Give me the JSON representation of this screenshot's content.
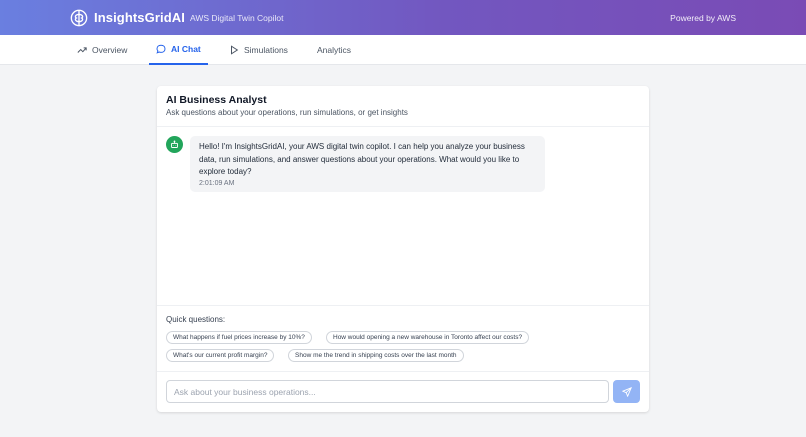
{
  "header": {
    "brand": "InsightsGridAI",
    "tagline": "AWS Digital Twin Copilot",
    "powered_by": "Powered by AWS"
  },
  "nav": {
    "tabs": [
      {
        "label": "Overview",
        "icon": "trending-up-icon",
        "active": false
      },
      {
        "label": "AI Chat",
        "icon": "chat-bubble-icon",
        "active": true
      },
      {
        "label": "Simulations",
        "icon": "play-icon",
        "active": false
      },
      {
        "label": "Analytics",
        "icon": "",
        "active": false
      }
    ]
  },
  "chat": {
    "title": "AI Business Analyst",
    "subtitle": "Ask questions about your operations, run simulations, or get insights",
    "messages": [
      {
        "sender": "assistant",
        "avatar_icon": "bot-icon",
        "text": "Hello! I'm InsightsGridAI, your AWS digital twin copilot. I can help you analyze your business data, run simulations, and answer questions about your operations. What would you like to explore today?",
        "time": "2:01:09 AM"
      }
    ],
    "quick_label": "Quick questions:",
    "quick_questions": [
      "What happens if fuel prices increase by 10%?",
      "How would opening a new warehouse in Toronto affect our costs?",
      "What's our current profit margin?",
      "Show me the trend in shipping costs over the last month"
    ],
    "input": {
      "value": "",
      "placeholder": "Ask about your business operations..."
    },
    "send_icon": "send-icon"
  },
  "colors": {
    "header_gradient_start": "#6a7fe0",
    "header_gradient_end": "#7a4bb5",
    "accent": "#2563eb",
    "avatar": "#22a55b",
    "send_button": "#93b4f5"
  }
}
